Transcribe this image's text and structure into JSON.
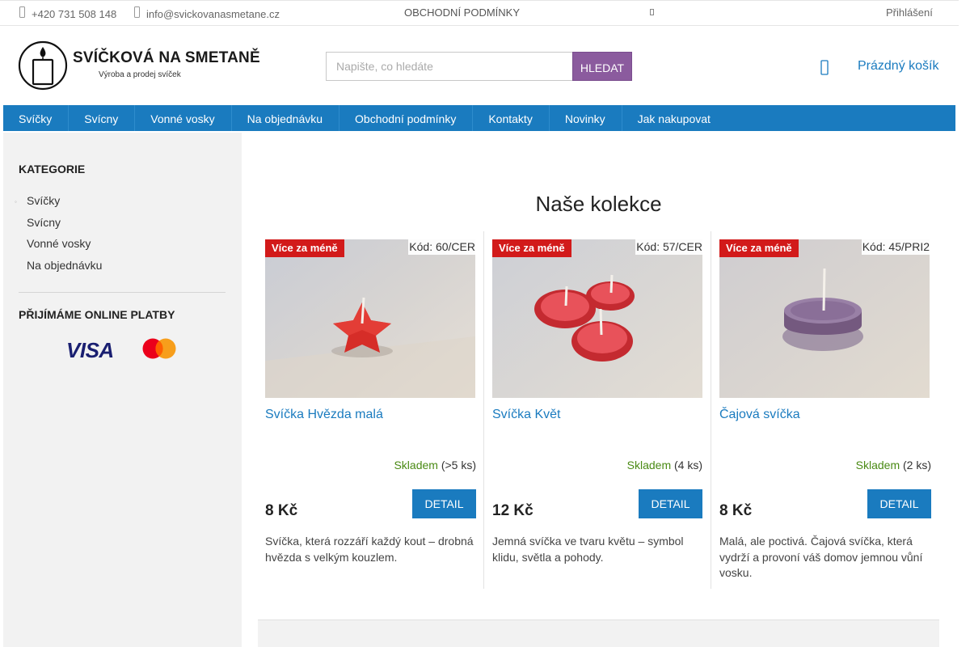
{
  "topbar": {
    "phone": "+420 731 508 148",
    "email": "info@svickovanasmetane.cz",
    "terms": "OBCHODNÍ PODMÍNKY",
    "login": "Přihlášení",
    "icons": [
      "phone-icon",
      "mail-icon",
      "misc-icon"
    ]
  },
  "logo": {
    "title": "SVÍČKOVÁ NA SMETANĚ",
    "subtitle": "Výroba a prodej svíček"
  },
  "search": {
    "placeholder": "Napište, co hledáte",
    "button": "HLEDAT",
    "button_color": "#8b5b9e"
  },
  "cart": {
    "label": "Prázdný košík"
  },
  "nav": {
    "color": "#1a7bbf",
    "items": [
      "Svíčky",
      "Svícny",
      "Vonné vosky",
      "Na objednávku",
      "Obchodní podmínky",
      "Kontakty",
      "Novinky",
      "Jak nakupovat"
    ]
  },
  "sidebar": {
    "categories_title": "KATEGORIE",
    "categories": [
      "Svíčky",
      "Svícny",
      "Vonné vosky",
      "Na objednávku"
    ],
    "payments_title": "PŘIJÍMÁME ONLINE PLATBY",
    "visa": "VISA"
  },
  "main": {
    "title": "Naše kolekce",
    "products": [
      {
        "flag": "Více za méně",
        "code": "Kód: 60/CER",
        "name": "Svíčka Hvězda malá",
        "stock_status": "Skladem",
        "stock_qty": "(>5 ks)",
        "price": "8 Kč",
        "button": "DETAIL",
        "description": "Svíčka, která rozzáří každý kout – drobná hvězda s velkým kouzlem.",
        "image": "red-star-candle"
      },
      {
        "flag": "Více za méně",
        "code": "Kód: 57/CER",
        "name": "Svíčka Květ",
        "stock_status": "Skladem",
        "stock_qty": "(4 ks)",
        "price": "12 Kč",
        "button": "DETAIL",
        "description": "Jemná svíčka ve tvaru květu – symbol klidu, světla a pohody.",
        "image": "red-flower-candles"
      },
      {
        "flag": "Více za méně",
        "code": "Kód: 45/PRI2",
        "name": "Čajová svíčka",
        "stock_status": "Skladem",
        "stock_qty": "(2 ks)",
        "price": "8 Kč",
        "button": "DETAIL",
        "description": "Malá, ale poctivá. Čajová svíčka, která vydrží a provoní váš domov jemnou vůní vosku.",
        "image": "purple-tea-candle"
      }
    ]
  },
  "colors": {
    "accent_blue": "#1a7bbf",
    "flag_red": "#d21a1a",
    "stock_green": "#4a8a14"
  }
}
